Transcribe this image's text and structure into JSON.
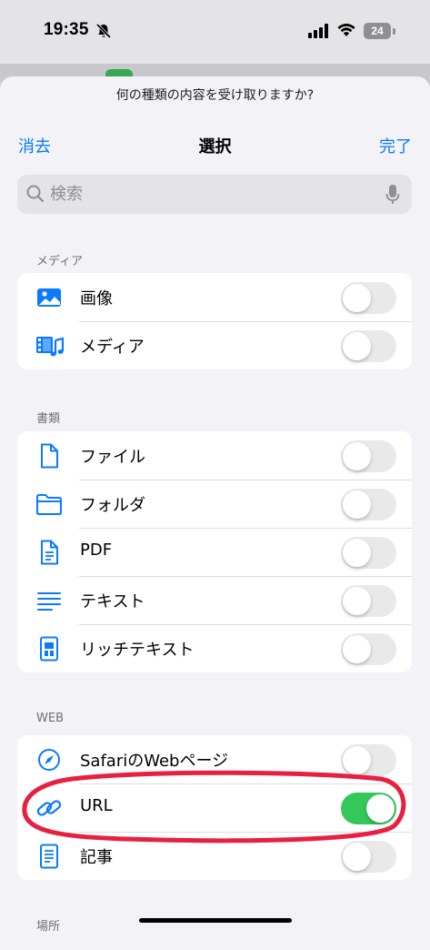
{
  "status": {
    "time": "19:35",
    "battery": "24"
  },
  "sheet": {
    "prompt": "何の種類の内容を受け取りますか?",
    "clear_label": "消去",
    "title": "選択",
    "done_label": "完了",
    "search_placeholder": "検索"
  },
  "sections": [
    {
      "header": "メディア",
      "items": [
        {
          "label": "画像",
          "icon": "photo-icon",
          "on": false
        },
        {
          "label": "メディア",
          "icon": "film-music-icon",
          "on": false
        }
      ]
    },
    {
      "header": "書類",
      "items": [
        {
          "label": "ファイル",
          "icon": "file-icon",
          "on": false
        },
        {
          "label": "フォルダ",
          "icon": "folder-icon",
          "on": false
        },
        {
          "label": "PDF",
          "icon": "pdf-document-icon",
          "on": false
        },
        {
          "label": "テキスト",
          "icon": "text-lines-icon",
          "on": false
        },
        {
          "label": "リッチテキスト",
          "icon": "rich-text-icon",
          "on": false
        }
      ]
    },
    {
      "header": "WEB",
      "items": [
        {
          "label": "SafariのWebページ",
          "icon": "compass-icon",
          "on": false
        },
        {
          "label": "URL",
          "icon": "link-icon",
          "on": true
        },
        {
          "label": "記事",
          "icon": "article-icon",
          "on": false
        }
      ]
    },
    {
      "header": "場所",
      "items": []
    }
  ],
  "colors": {
    "accent": "#0a7aff",
    "toggle_on": "#34c759",
    "toggle_off": "#e9e9ea",
    "annotation": "#e8203f"
  }
}
